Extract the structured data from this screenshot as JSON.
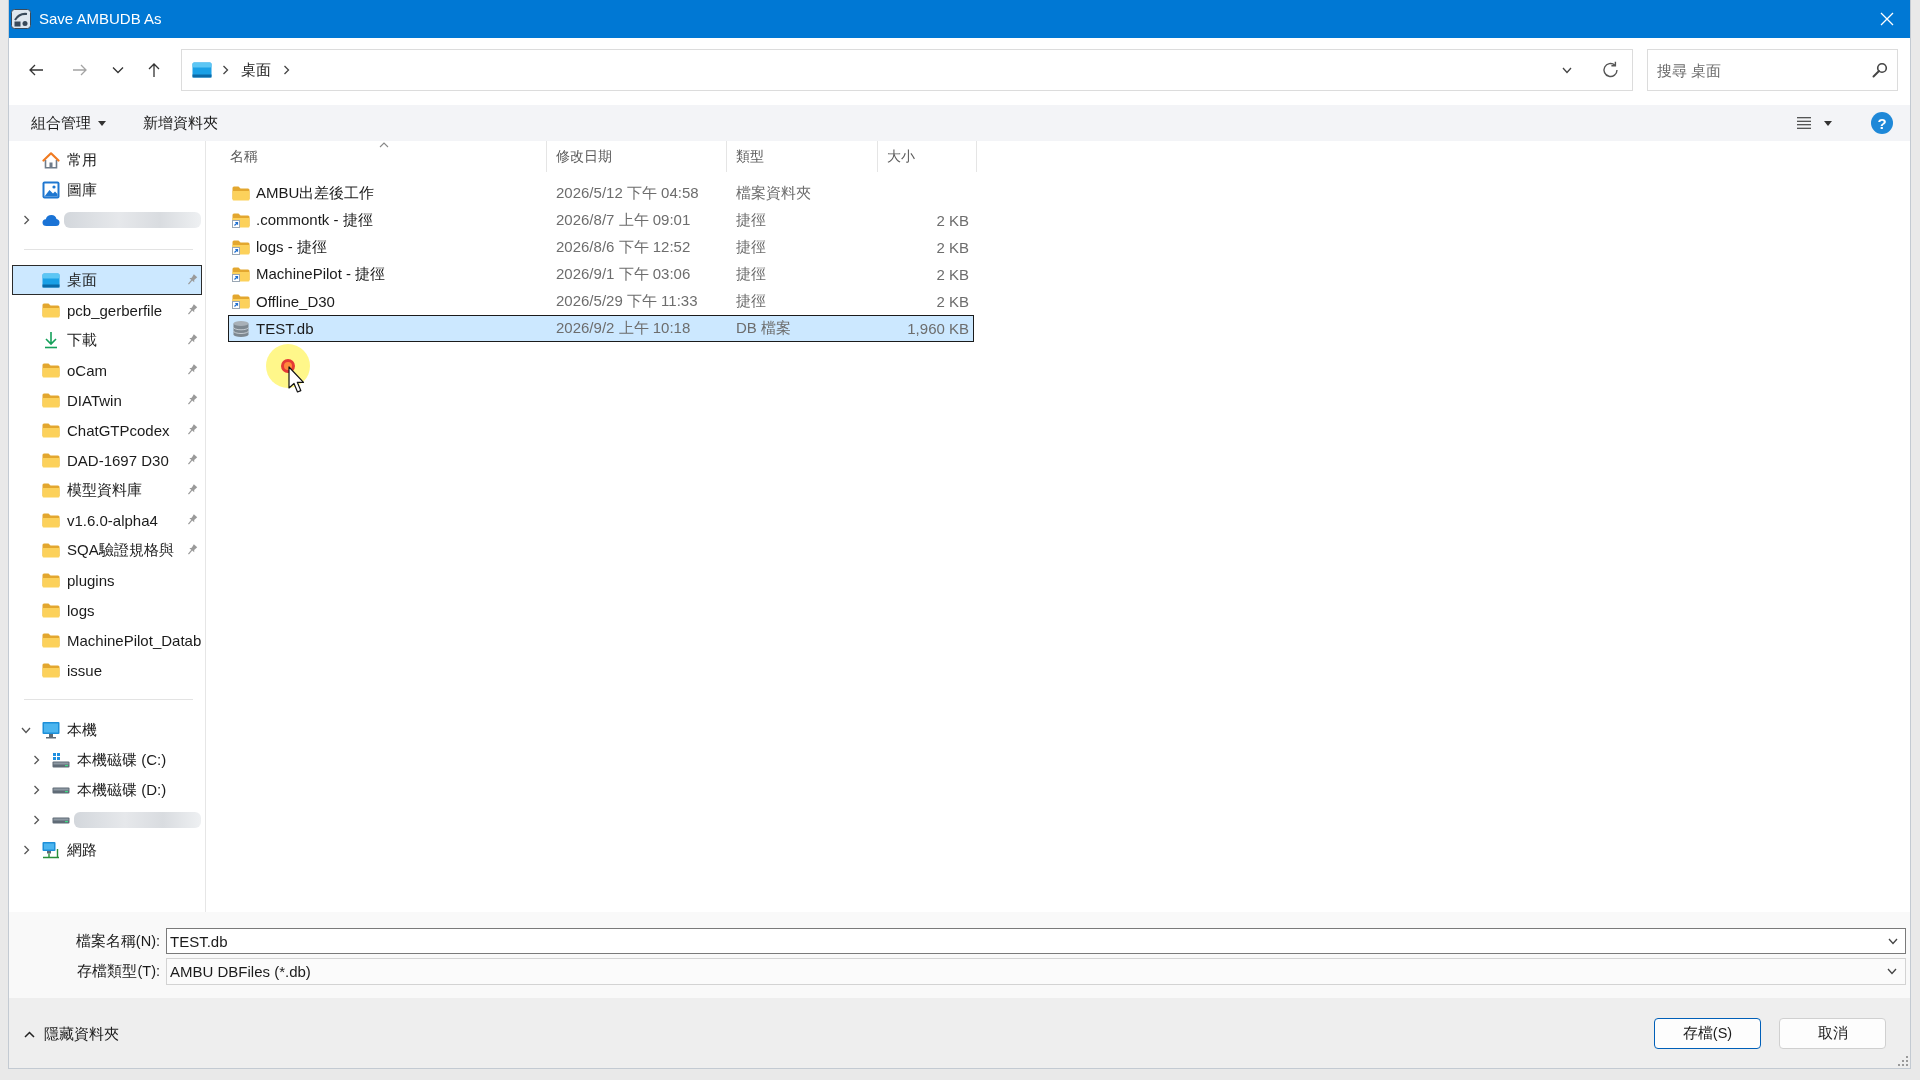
{
  "window": {
    "title": "Save AMBUDB As"
  },
  "navigation": {
    "buttons": [
      {
        "kind": "back",
        "disabled": false
      },
      {
        "kind": "forward",
        "disabled": true
      },
      {
        "kind": "recent",
        "disabled": false
      },
      {
        "kind": "up",
        "disabled": false
      }
    ]
  },
  "address_bar": {
    "breadcrumbs": [
      {
        "label": "桌面"
      }
    ]
  },
  "search": {
    "placeholder": "搜尋 桌面"
  },
  "toolbar": {
    "items": [
      {
        "label": "組合管理",
        "kind": "menu"
      },
      {
        "label": "新增資料夾",
        "kind": "button"
      }
    ],
    "help": {
      "label": "?"
    }
  },
  "sidebar": {
    "sections": [
      {
        "items": [
          {
            "label": "常用",
            "kind": "home",
            "selected": false
          },
          {
            "label": "圖庫",
            "kind": "gallery",
            "selected": false
          },
          {
            "kind": "cloud",
            "expanded": false,
            "selected": false
          }
        ]
      },
      {
        "items": [
          {
            "label": "桌面",
            "kind": "desktop",
            "pinned": true,
            "selected": true
          },
          {
            "label": "pcb_gerberfile",
            "kind": "folder",
            "pinned": true,
            "selected": false
          },
          {
            "label": "下載",
            "kind": "download",
            "pinned": true,
            "selected": false
          },
          {
            "label": "oCam",
            "kind": "folder",
            "pinned": true,
            "selected": false
          },
          {
            "label": "DIATwin",
            "kind": "folder",
            "pinned": true,
            "selected": false
          },
          {
            "label": "ChatGTPcodex",
            "kind": "folder",
            "pinned": true,
            "selected": false
          },
          {
            "label": "DAD-1697 D30",
            "kind": "folder",
            "pinned": true,
            "selected": false
          },
          {
            "label": "模型資料庫",
            "kind": "folder",
            "pinned": true,
            "selected": false
          },
          {
            "label": "v1.6.0-alpha4",
            "kind": "folder",
            "pinned": true,
            "selected": false
          },
          {
            "label": "SQA驗證規格與",
            "kind": "folder",
            "pinned": true,
            "selected": false
          },
          {
            "label": "plugins",
            "kind": "folder",
            "pinned": false,
            "selected": false
          },
          {
            "label": "logs",
            "kind": "folder",
            "pinned": false,
            "selected": false
          },
          {
            "label": "MachinePilot_Datab",
            "kind": "folder",
            "pinned": false,
            "selected": false
          },
          {
            "label": "issue",
            "kind": "folder",
            "pinned": false,
            "selected": false
          }
        ]
      },
      {
        "items": [
          {
            "label": "本機",
            "kind": "computer",
            "expanded": true,
            "selected": false,
            "children": [
              {
                "label": "本機磁碟 (C:)",
                "kind": "system",
                "expanded": false,
                "selected": false
              },
              {
                "label": "本機磁碟 (D:)",
                "kind": "drive",
                "expanded": false,
                "selected": false
              },
              {
                "kind": "drive",
                "expanded": false,
                "selected": false
              }
            ]
          },
          {
            "label": "網路",
            "kind": "network",
            "expanded": false,
            "selected": false
          }
        ]
      }
    ]
  },
  "file_list": {
    "columns": [
      {
        "label": "名稱",
        "sorted": true
      },
      {
        "label": "修改日期",
        "sorted": false
      },
      {
        "label": "類型",
        "sorted": false
      },
      {
        "label": "大小",
        "sorted": false
      }
    ],
    "rows": [
      {
        "name": "AMBU出差後工作",
        "modified": "2026/5/12 下午 04:58",
        "type": "檔案資料夾",
        "kind": "folder",
        "selected": false
      },
      {
        "name": ".commontk - 捷徑",
        "modified": "2026/8/7 上午 09:01",
        "type": "捷徑",
        "size": "2 KB",
        "kind": "shortcut",
        "selected": false
      },
      {
        "name": "logs - 捷徑",
        "modified": "2026/8/6 下午 12:52",
        "type": "捷徑",
        "size": "2 KB",
        "kind": "shortcut",
        "selected": false
      },
      {
        "name": "MachinePilot - 捷徑",
        "modified": "2026/9/1 下午 03:06",
        "type": "捷徑",
        "size": "2 KB",
        "kind": "shortcut",
        "selected": false
      },
      {
        "name": "Offline_D30",
        "modified": "2026/5/29 下午 11:33",
        "type": "捷徑",
        "size": "2 KB",
        "kind": "shortcut",
        "selected": false
      },
      {
        "name": "TEST.db",
        "modified": "2026/9/2 上午 10:18",
        "type": "DB 檔案",
        "size": "1,960 KB",
        "kind": "database",
        "selected": true
      }
    ]
  },
  "save_form": {
    "fields": [
      {
        "label": "檔案名稱(N):",
        "value": "TEST.db",
        "kind": "combo"
      },
      {
        "label": "存檔類型(T):",
        "value": "AMBU DBFiles (*.db)",
        "kind": "select"
      }
    ]
  },
  "footer": {
    "toggle": {
      "label": "隱藏資料夾",
      "expanded": true
    },
    "buttons": [
      {
        "label": "存檔(S)",
        "default": true
      },
      {
        "label": "取消",
        "default": false
      }
    ]
  }
}
